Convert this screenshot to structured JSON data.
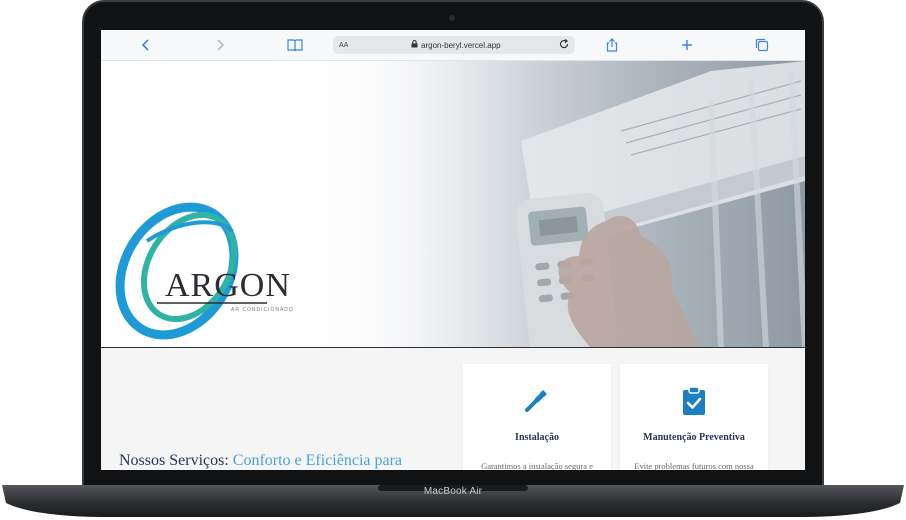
{
  "device": {
    "label": "MacBook Air"
  },
  "browser": {
    "reader_label": "AA",
    "url": "argon-beryl.vercel.app"
  },
  "hero": {
    "logo_text": "ARGON",
    "logo_subtext": "AR CONDICIONADO"
  },
  "services": {
    "title_prefix": "Nossos Serviços:",
    "title_accent": "Conforto e Eficiência para",
    "cards": [
      {
        "icon": "wrench-icon",
        "title": "Instalação",
        "text": "Garantimos a instalação segura e eficiente do seu ar-condicionado"
      },
      {
        "icon": "clipboard-check-icon",
        "title": "Manutenção Preventiva",
        "text": "Evite problemas futuros com nossa manutenção regular"
      }
    ]
  },
  "colors": {
    "accent": "#4aa3d8",
    "navy": "#27345a",
    "logo_blue": "#1e9bd7",
    "logo_teal": "#2fb3a6"
  }
}
